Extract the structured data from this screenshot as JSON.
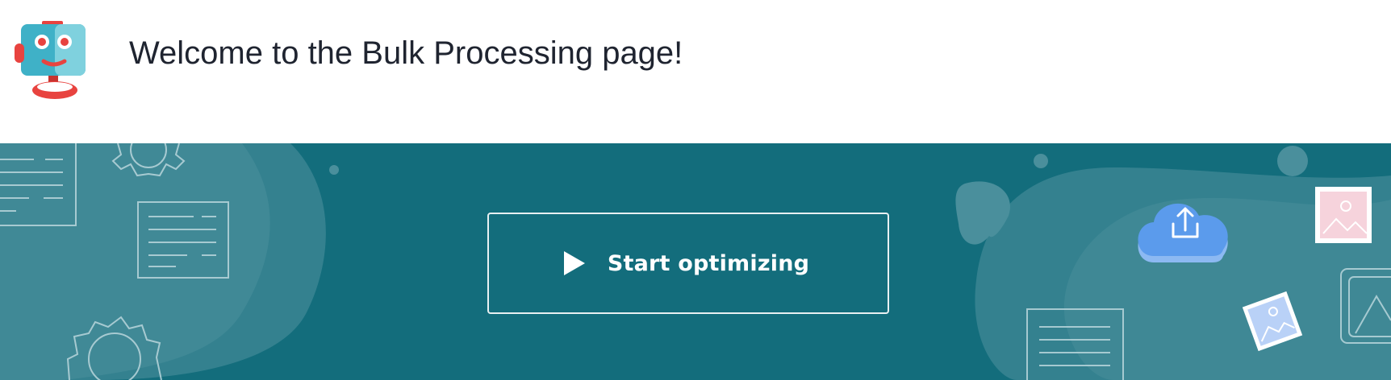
{
  "header": {
    "welcome_text": "Welcome to the Bulk Processing page!",
    "mascot_icon": "robot-mascot-icon"
  },
  "banner": {
    "background_color": "#136d7c",
    "start_button": {
      "label": "Start optimizing",
      "icon": "play-icon"
    },
    "decorations": [
      "document-icon",
      "gear-icon",
      "cloud-upload-icon",
      "image-icon"
    ]
  },
  "colors": {
    "banner": "#136d7c",
    "cloud": "#5b9bec",
    "image_pink": "#f6d3dc",
    "image_blue": "#b9d1f7",
    "text": "#1f2430"
  }
}
